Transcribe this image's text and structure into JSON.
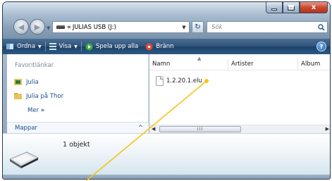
{
  "window": {
    "caption_buttons": {
      "minimize_icon": "minimize-icon",
      "maximize_icon": "maximize-icon",
      "close_icon": "close-icon",
      "close_glyph": "x"
    },
    "address": {
      "prefix": "«",
      "path": "JULIAS USB (J:)"
    },
    "search": {
      "placeholder": "Sök"
    }
  },
  "toolbar": {
    "organize": "Ordna",
    "views": "Visa",
    "play_all": "Spela upp alla",
    "burn": "Bränn",
    "help": "?"
  },
  "nav_pane": {
    "favorites_header": "Favoritlänkar",
    "items": [
      {
        "label": "Julia",
        "icon": "user-folder-icon"
      },
      {
        "label": "Julia på Thor",
        "icon": "folder-icon"
      }
    ],
    "more": "Mer",
    "more_arrow": "»",
    "folders": "Mappar",
    "folders_toggle": "^"
  },
  "file_list": {
    "columns": [
      "Namn",
      "Artister",
      "Album"
    ],
    "files": [
      {
        "name": "1.2.20.1.elu"
      }
    ],
    "scroll_grip": "III"
  },
  "details": {
    "count": "1 objekt"
  },
  "colors": {
    "toolbar": "#2f537a",
    "link": "#1b4f8a",
    "annotation": "#f5c518"
  }
}
